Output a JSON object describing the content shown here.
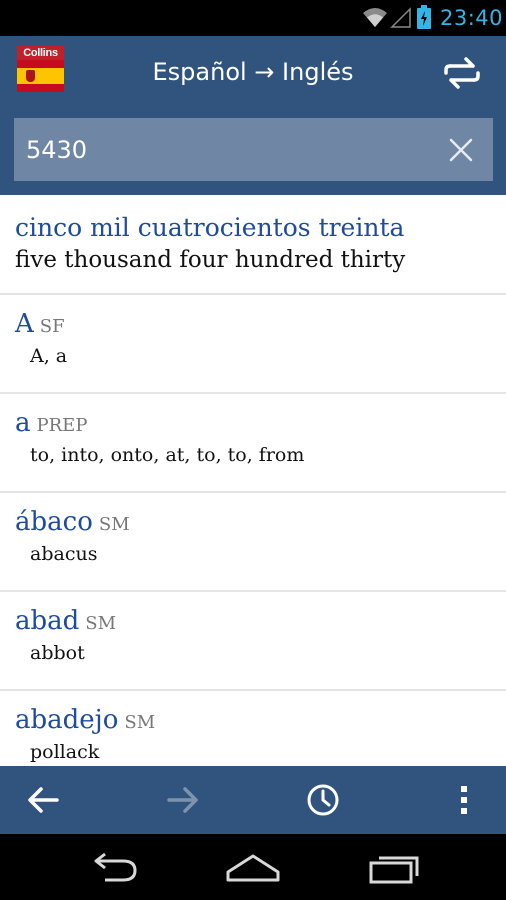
{
  "status_bar": {
    "time": "23:40"
  },
  "header": {
    "logo_text": "Collins",
    "title": "Español → Inglés"
  },
  "search": {
    "value": "5430"
  },
  "results": {
    "number_entry": {
      "headword": "cinco mil cuatrocientos treinta",
      "translation": "five thousand four hundred thirty"
    },
    "entries": [
      {
        "headword": "A",
        "pos": "SF",
        "translation": "A, a"
      },
      {
        "headword": "a",
        "pos": "PREP",
        "translation": "to, into, onto, at, to, to, from"
      },
      {
        "headword": "ábaco",
        "pos": "SM",
        "translation": "abacus"
      },
      {
        "headword": "abad",
        "pos": "SM",
        "translation": "abbot"
      },
      {
        "headword": "abadejo",
        "pos": "SM",
        "translation": "pollack"
      }
    ]
  },
  "colors": {
    "action_bar": "#31547e",
    "search_box": "#6f87a4",
    "headword": "#1d4b9d",
    "status_time": "#33b5e5"
  }
}
